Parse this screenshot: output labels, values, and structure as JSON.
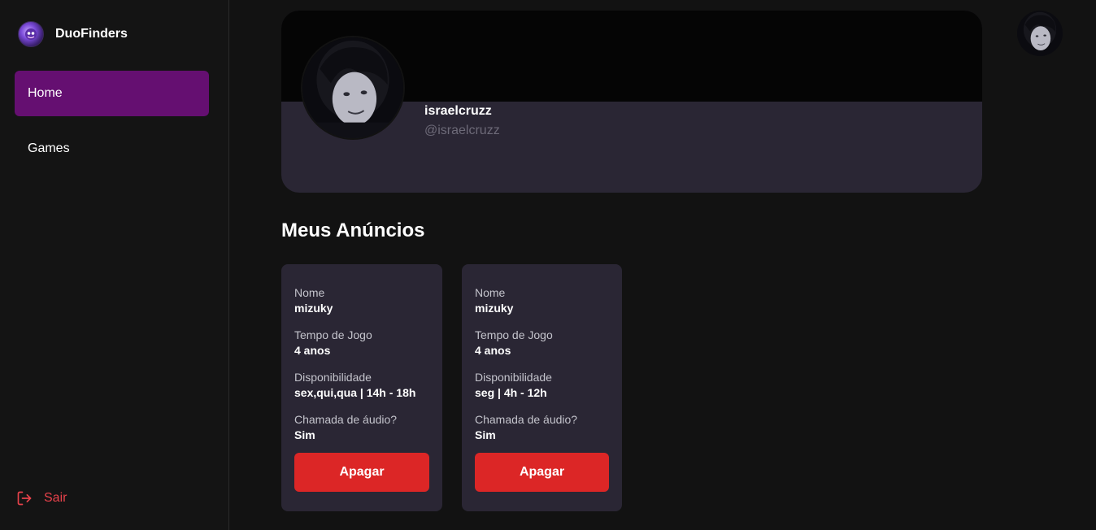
{
  "app": {
    "name": "DuoFinders",
    "logo_icon": "duofinders-logo-icon"
  },
  "sidebar": {
    "items": [
      {
        "label": "Home",
        "active": true
      },
      {
        "label": "Games",
        "active": false
      }
    ],
    "logout_label": "Sair",
    "logout_icon": "logout-icon"
  },
  "profile": {
    "username": "israelcruzz",
    "handle": "@israelcruzz",
    "avatar_icon": "user-avatar"
  },
  "ads_section": {
    "title": "Meus Anúncios"
  },
  "ads": [
    {
      "fields": [
        {
          "label": "Nome",
          "value": "mizuky"
        },
        {
          "label": "Tempo de Jogo",
          "value": "4 anos"
        },
        {
          "label": "Disponibilidade",
          "value": "sex,qui,qua | 14h - 18h"
        },
        {
          "label": "Chamada de áudio?",
          "value": "Sim"
        }
      ],
      "delete_label": "Apagar"
    },
    {
      "fields": [
        {
          "label": "Nome",
          "value": "mizuky"
        },
        {
          "label": "Tempo de Jogo",
          "value": "4 anos"
        },
        {
          "label": "Disponibilidade",
          "value": "seg | 4h - 12h"
        },
        {
          "label": "Chamada de áudio?",
          "value": "Sim"
        }
      ],
      "delete_label": "Apagar"
    }
  ],
  "colors": {
    "background": "#121212",
    "sidebar_active": "#650f71",
    "card": "#2a2634",
    "danger": "#dc2626",
    "logout": "#e8424b"
  }
}
